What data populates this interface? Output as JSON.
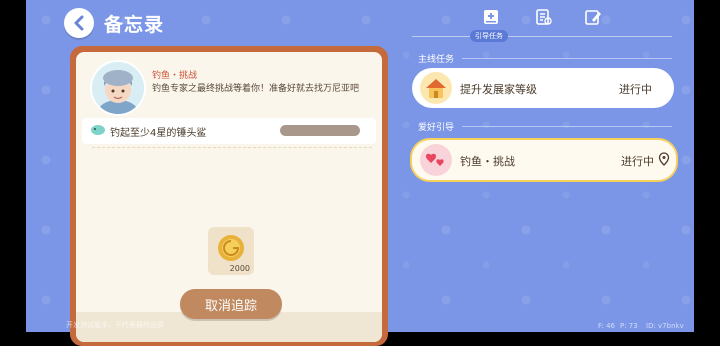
{
  "header": {
    "title": "备忘录"
  },
  "quest": {
    "name": "钓鱼・挑战",
    "description": "钓鱼专家之最终挑战等着你！准备好就去找万尼亚吧",
    "task": "钓起至少4星的锤头鲨",
    "reward_count": "2000",
    "cancel_label": "取消追踪"
  },
  "right": {
    "tab_label": "引导任务",
    "sections": [
      {
        "label": "主线任务",
        "task_title": "提升发展家等级",
        "status": "进行中"
      },
      {
        "label": "爱好引导",
        "task_title": "钓鱼・挑战",
        "status": "进行中"
      }
    ]
  },
  "footer": {
    "left": "开发测试版本，不代表最终品质",
    "f": "F: 46",
    "p": "P: 73",
    "id": "ID: v7bnkv"
  },
  "colors": {
    "background": "#7b96e6",
    "frame": "#c56a3c",
    "panel": "#fbf6ec",
    "accent": "#c9543a",
    "button": "#c08960",
    "highlight": "#f6d25b"
  }
}
